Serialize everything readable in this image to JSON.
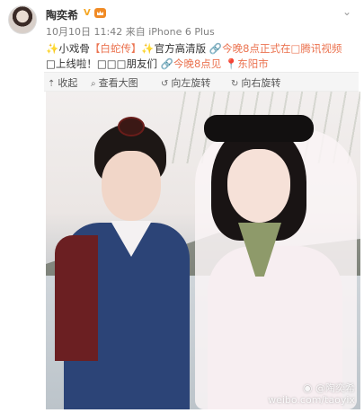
{
  "post": {
    "author": "陶奕希",
    "vip_badge": "V",
    "badges": [
      "vip-icon",
      "crown-icon"
    ],
    "more_icon": "chevron-down-icon",
    "date": "10月10日 11:42",
    "source_prefix": "来自",
    "source": "iPhone 6 Plus",
    "content": {
      "sparkle": "✨",
      "part1": "小戏骨",
      "topic": "【白蛇传】",
      "part2": "官方高清版",
      "link_icon": "🔗",
      "link1": "今晚8点正式在□腾讯视频",
      "line2a": "□上线啦！□□□朋友们",
      "link2": "今晚8点见",
      "location_icon": "📍",
      "location": "东阳市"
    }
  },
  "toolbar": {
    "collapse": "收起",
    "view_large": "查看大图",
    "rotate_left": "向左旋转",
    "rotate_right": "向右旋转"
  },
  "image": {
    "watermark_name": "@陶奕希",
    "watermark_url": "weibo.com/taoyix",
    "colors": {
      "boy_robe": "#2c4477",
      "boy_vest": "#6b1f22",
      "girl_dress": "#f7eef1"
    }
  },
  "colors": {
    "link": "#eb7350",
    "vip": "#f5a623",
    "meta": "#808080"
  }
}
